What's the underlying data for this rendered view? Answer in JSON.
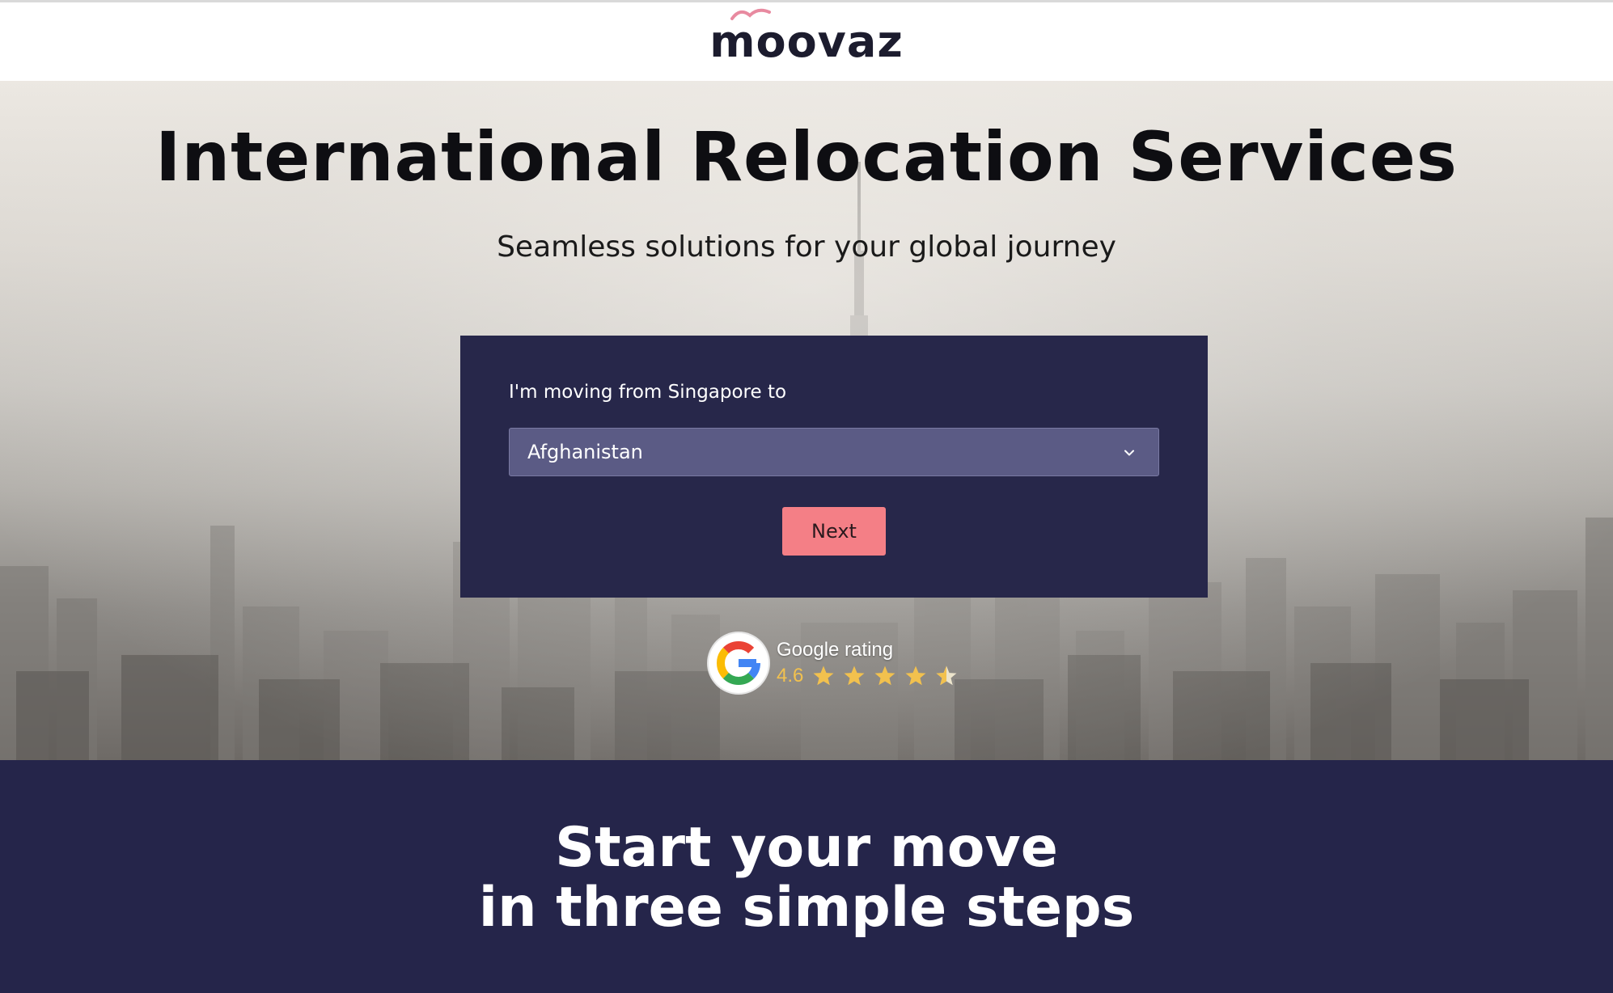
{
  "brand": {
    "name": "moovaz",
    "accent_color": "#e88aa0"
  },
  "hero": {
    "title": "International Relocation Services",
    "subtitle": "Seamless solutions for your global journey"
  },
  "move_form": {
    "label": "I'm moving from Singapore to",
    "destination_selected": "Afghanistan",
    "next_label": "Next",
    "card_color": "#27274a",
    "button_color": "#f47f86"
  },
  "rating": {
    "label": "Google rating",
    "value": "4.6",
    "stars": 4.6,
    "icon": "google-g-icon"
  },
  "steps_section": {
    "title_line1": "Start your move",
    "title_line2": "in three simple steps",
    "background": "#25254a"
  }
}
